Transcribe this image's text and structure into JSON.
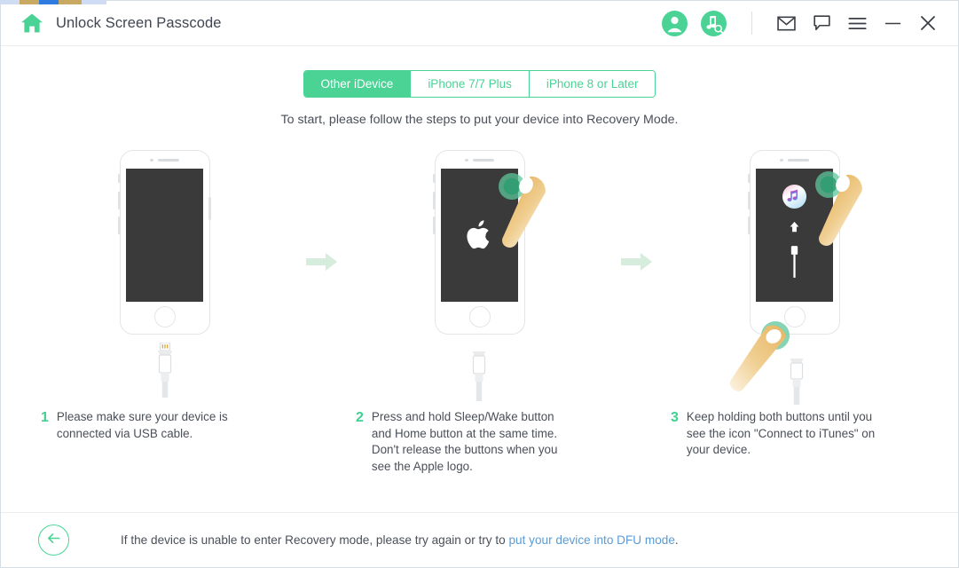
{
  "window": {
    "title": "Unlock Screen Passcode",
    "home_icon": "home-icon",
    "accent_green": "#4ad395",
    "link_blue": "#5b9bd5"
  },
  "titlebar": {
    "account_icon": "user-account-icon",
    "music_search_icon": "music-search-icon",
    "mail_icon": "mail-icon",
    "feedback_icon": "chat-bubble-icon",
    "menu_icon": "hamburger-menu-icon",
    "minimize_icon": "minimize-icon",
    "close_icon": "close-icon"
  },
  "tabs": [
    {
      "label": "Other iDevice",
      "active": true
    },
    {
      "label": "iPhone 7/7 Plus",
      "active": false
    },
    {
      "label": "iPhone 8 or Later",
      "active": false
    }
  ],
  "main": {
    "subtitle": "To start, please follow the steps to put your device into Recovery Mode."
  },
  "steps": [
    {
      "number": "1",
      "text": "Please make sure your device is connected via USB cable.",
      "screen": "blank-dark-screen",
      "arrow_after": true
    },
    {
      "number": "2",
      "text": "Press and hold Sleep/Wake button and Home button at the same time. Don't release the buttons when you see the Apple logo.",
      "screen": "apple-logo-screen",
      "arrow_after": true
    },
    {
      "number": "3",
      "text": "Keep holding both buttons until you see the icon \"Connect to iTunes\" on your device.",
      "screen": "connect-to-itunes-screen",
      "arrow_after": false
    }
  ],
  "footer": {
    "back_icon": "back-arrow-icon",
    "text_before": "If the device is unable to enter Recovery mode, please try again or try to ",
    "link_text": "put your device into DFU mode",
    "text_after": "."
  }
}
